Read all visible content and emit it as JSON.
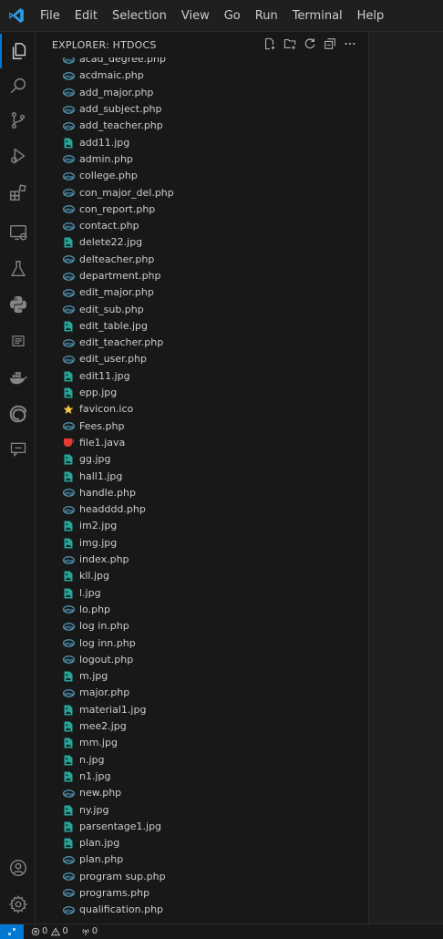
{
  "menu": [
    "File",
    "Edit",
    "Selection",
    "View",
    "Go",
    "Run",
    "Terminal",
    "Help"
  ],
  "sidebar": {
    "title": "EXPLORER: HTDOCS",
    "actions": [
      "new-file-icon",
      "new-folder-icon",
      "refresh-icon",
      "collapse-all-icon",
      "more-icon"
    ]
  },
  "files": [
    {
      "name": "acad_degree.php",
      "type": "php"
    },
    {
      "name": "acdmaic.php",
      "type": "php"
    },
    {
      "name": "add_major.php",
      "type": "php"
    },
    {
      "name": "add_subject.php",
      "type": "php"
    },
    {
      "name": "add_teacher.php",
      "type": "php"
    },
    {
      "name": "add11.jpg",
      "type": "image"
    },
    {
      "name": "admin.php",
      "type": "php"
    },
    {
      "name": "college.php",
      "type": "php"
    },
    {
      "name": "con_major_del.php",
      "type": "php"
    },
    {
      "name": "con_report.php",
      "type": "php"
    },
    {
      "name": "contact.php",
      "type": "php"
    },
    {
      "name": "delete22.jpg",
      "type": "image"
    },
    {
      "name": "delteacher.php",
      "type": "php"
    },
    {
      "name": "department.php",
      "type": "php"
    },
    {
      "name": "edit_major.php",
      "type": "php"
    },
    {
      "name": "edit_sub.php",
      "type": "php"
    },
    {
      "name": "edit_table.jpg",
      "type": "image"
    },
    {
      "name": "edit_teacher.php",
      "type": "php"
    },
    {
      "name": "edit_user.php",
      "type": "php"
    },
    {
      "name": "edit11.jpg",
      "type": "image"
    },
    {
      "name": "epp.jpg",
      "type": "image"
    },
    {
      "name": "favicon.ico",
      "type": "ico"
    },
    {
      "name": "Fees.php",
      "type": "php"
    },
    {
      "name": "file1.java",
      "type": "java"
    },
    {
      "name": "gg.jpg",
      "type": "image"
    },
    {
      "name": "hall1.jpg",
      "type": "image"
    },
    {
      "name": "handle.php",
      "type": "php"
    },
    {
      "name": "headddd.php",
      "type": "php"
    },
    {
      "name": "im2.jpg",
      "type": "image"
    },
    {
      "name": "img.jpg",
      "type": "image"
    },
    {
      "name": "index.php",
      "type": "php"
    },
    {
      "name": "kll.jpg",
      "type": "image"
    },
    {
      "name": "l.jpg",
      "type": "image"
    },
    {
      "name": "lo.php",
      "type": "php"
    },
    {
      "name": "log in.php",
      "type": "php"
    },
    {
      "name": "log inn.php",
      "type": "php"
    },
    {
      "name": "logout.php",
      "type": "php"
    },
    {
      "name": "m.jpg",
      "type": "image"
    },
    {
      "name": "major.php",
      "type": "php"
    },
    {
      "name": "material1.jpg",
      "type": "image"
    },
    {
      "name": "mee2.jpg",
      "type": "image"
    },
    {
      "name": "mm.jpg",
      "type": "image"
    },
    {
      "name": "n.jpg",
      "type": "image"
    },
    {
      "name": "n1.jpg",
      "type": "image"
    },
    {
      "name": "new.php",
      "type": "php"
    },
    {
      "name": "ny.jpg",
      "type": "image"
    },
    {
      "name": "parsentage1.jpg",
      "type": "image"
    },
    {
      "name": "plan.jpg",
      "type": "image"
    },
    {
      "name": "plan.php",
      "type": "php"
    },
    {
      "name": "program sup.php",
      "type": "php"
    },
    {
      "name": "programs.php",
      "type": "php"
    },
    {
      "name": "qualification.php",
      "type": "php"
    }
  ],
  "status": {
    "errors": "0",
    "warnings": "0",
    "ports": "0"
  },
  "colors": {
    "accent": "#0078d4",
    "php": "#519aba",
    "image": "#26a69a",
    "java": "#e53935",
    "ico": "#f7c948"
  }
}
